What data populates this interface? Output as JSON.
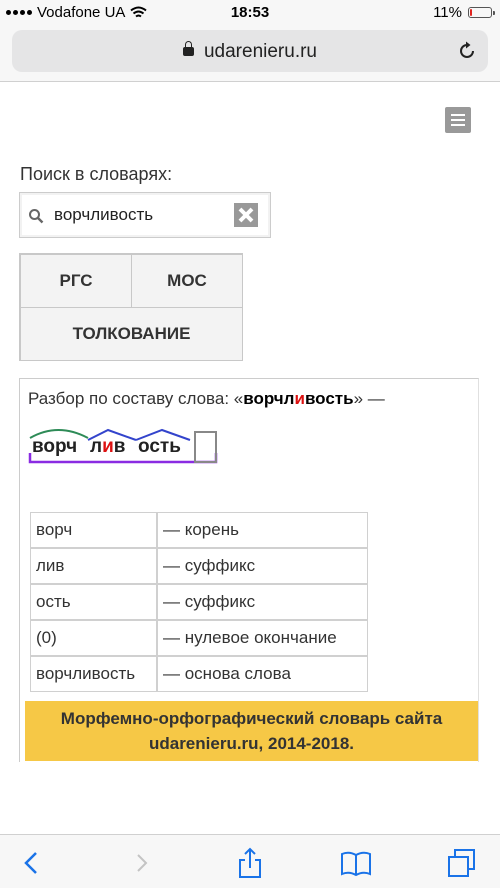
{
  "status": {
    "carrier": "Vodafone UA",
    "time": "18:53",
    "battery": "11%",
    "battery_level": 0.11
  },
  "browser": {
    "url": "udarenieru.ru"
  },
  "search": {
    "label": "Поиск в словарях:",
    "value": "ворчливость"
  },
  "dictionaries": {
    "rgs": "РГС",
    "mos": "МОС",
    "tolk": "ТОЛКОВАНИЕ"
  },
  "analysis": {
    "prefix": "Разбор по составу слова: «",
    "word_start": "ворчл",
    "word_stress": "и",
    "word_end": "вость",
    "suffix": "» —",
    "morph_root": "ворч",
    "morph_suffix1_a": "л",
    "morph_suffix1_stress": "и",
    "morph_suffix1_b": "в",
    "morph_suffix2": "ость"
  },
  "parts": [
    {
      "part": "ворч",
      "desc": "— корень"
    },
    {
      "part": "лив",
      "desc": "— суффикс"
    },
    {
      "part": "ость",
      "desc": "— суффикс"
    },
    {
      "part": "(0)",
      "desc": "— нулевое окончание"
    },
    {
      "part": "ворчливость",
      "desc": "— основа слова"
    }
  ],
  "footer": {
    "line1": "Морфемно-орфографический словарь сайта",
    "line2": "udarenieru.ru, 2014-2018."
  },
  "colors": {
    "accent_stress": "#dd1111",
    "base_underline": "#8a2be2",
    "root_arc": "#2e8b57",
    "suffix_cap": "#3344cc",
    "note_bg": "#f6c846"
  }
}
